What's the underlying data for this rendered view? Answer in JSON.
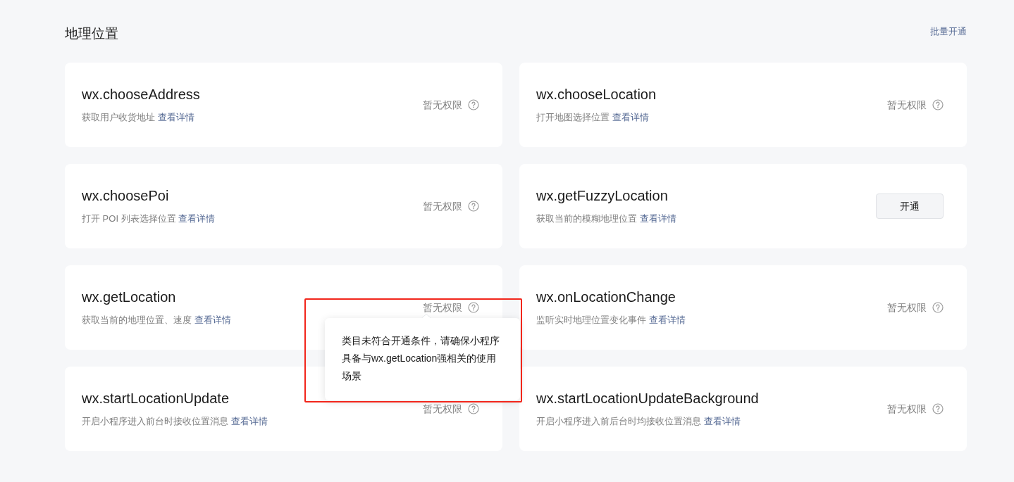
{
  "section": {
    "title": "地理位置",
    "batch_link": "批量开通"
  },
  "apis": [
    {
      "name": "wx.chooseAddress",
      "description": "获取用户收货地址",
      "details_link": "查看详情",
      "kind": "status",
      "status": "暂无权限"
    },
    {
      "name": "wx.chooseLocation",
      "description": "打开地图选择位置",
      "details_link": "查看详情",
      "kind": "status",
      "status": "暂无权限"
    },
    {
      "name": "wx.choosePoi",
      "description": "打开 POI 列表选择位置",
      "details_link": "查看详情",
      "kind": "status",
      "status": "暂无权限"
    },
    {
      "name": "wx.getFuzzyLocation",
      "description": "获取当前的模糊地理位置",
      "details_link": "查看详情",
      "kind": "button",
      "button": "开通"
    },
    {
      "name": "wx.getLocation",
      "description": "获取当前的地理位置、速度",
      "details_link": "查看详情",
      "kind": "status",
      "status": "暂无权限"
    },
    {
      "name": "wx.onLocationChange",
      "description": "监听实时地理位置变化事件",
      "details_link": "查看详情",
      "kind": "status",
      "status": "暂无权限"
    },
    {
      "name": "wx.startLocationUpdate",
      "description": "开启小程序进入前台时接收位置消息",
      "details_link": "查看详情",
      "kind": "status",
      "status": "暂无权限"
    },
    {
      "name": "wx.startLocationUpdateBackground",
      "description": "开启小程序进入前后台时均接收位置消息",
      "details_link": "查看详情",
      "kind": "status",
      "status": "暂无权限"
    }
  ],
  "tooltip": {
    "text": "类目未符合开通条件，请确保小程序具备与wx.getLocation强相关的使用场景",
    "highlighted": true
  }
}
